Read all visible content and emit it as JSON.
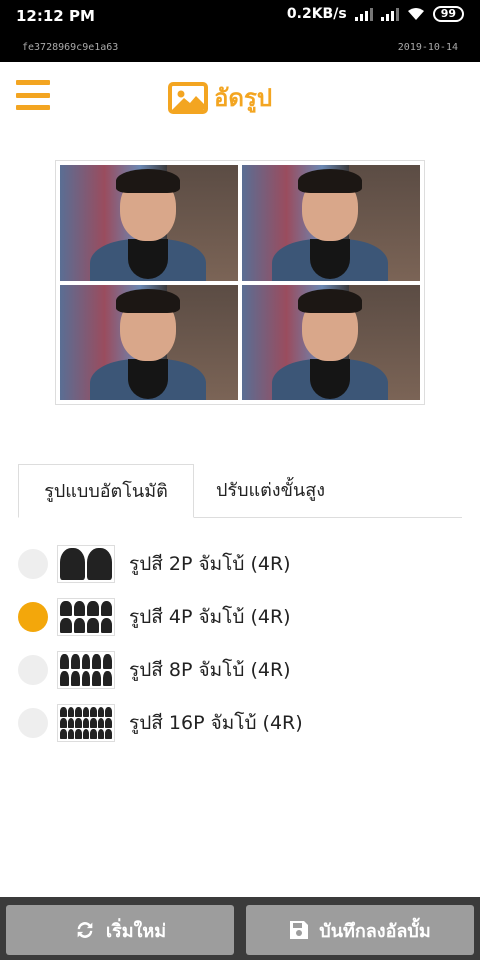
{
  "status_bar": {
    "time": "12:12 PM",
    "speed": "0.2KB/s",
    "battery": "99"
  },
  "meta": {
    "id": "fe3728969c9e1a63",
    "date": "2019-10-14"
  },
  "header": {
    "logo_text": "อัดรูป"
  },
  "tabs": [
    {
      "label": "รูปแบบอัตโนมัติ",
      "active": true
    },
    {
      "label": "ปรับแต่งขั้นสูง",
      "active": false
    }
  ],
  "options": [
    {
      "label": "รูปสี 2P จัมโบ้ (4R)",
      "selected": false
    },
    {
      "label": "รูปสี 4P จัมโบ้ (4R)",
      "selected": true
    },
    {
      "label": "รูปสี 8P จัมโบ้ (4R)",
      "selected": false
    },
    {
      "label": "รูปสี 16P จัมโบ้ (4R)",
      "selected": false
    }
  ],
  "buttons": {
    "reset": "เริ่มใหม่",
    "save": "บันทึกลงอัลบั้ม"
  },
  "colors": {
    "accent": "#f3a521",
    "button": "#9d9d9d",
    "bottom_bar": "#3b3b3b"
  },
  "icons": {
    "menu": "hamburger-icon",
    "logo": "image-icon",
    "reset": "refresh-icon",
    "save": "floppy-disk-icon"
  }
}
